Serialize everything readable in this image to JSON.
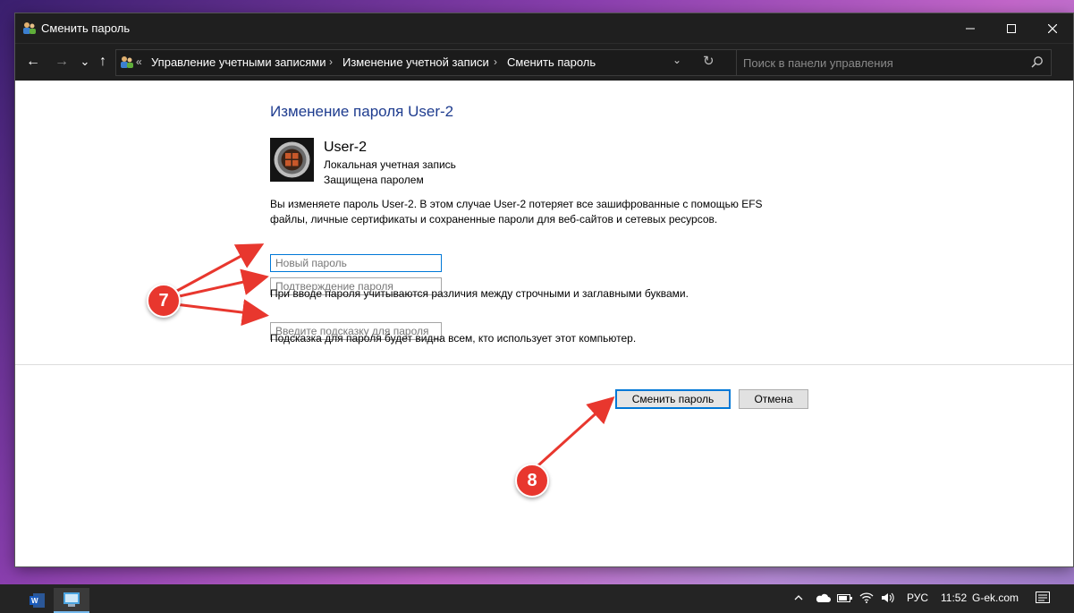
{
  "window": {
    "title": "Сменить пароль",
    "controls": {
      "minimize": "—",
      "maximize": "☐",
      "close": "✕"
    }
  },
  "address_bar": {
    "back": "←",
    "forward": "→",
    "history": "⌄",
    "up": "↑",
    "overflow": "«",
    "breadcrumbs": [
      "Управление учетными записями",
      "Изменение учетной записи",
      "Сменить пароль"
    ],
    "separator": "›",
    "dropdown": "⌄",
    "refresh": "↻",
    "search_placeholder": "Поиск в панели управления"
  },
  "page": {
    "heading": "Изменение пароля User-2",
    "user_name": "User-2",
    "account_type": "Локальная учетная запись",
    "protection": "Защищена паролем",
    "warning_line1": "Вы изменяете пароль User-2. В этом случае User-2 потеряет все зашифрованные с помощью EFS",
    "warning_line2": "файлы, личные сертификаты и сохраненные пароли для веб-сайтов и сетевых ресурсов.",
    "new_password_placeholder": "Новый пароль",
    "confirm_password_placeholder": "Подтверждение пароля",
    "case_note": "При вводе пароля учитываются различия между строчными и заглавными буквами.",
    "hint_placeholder": "Введите подсказку для пароля",
    "hint_note": "Подсказка для пароля будет видна всем, кто использует этот компьютер.",
    "change_button": "Сменить пароль",
    "cancel_button": "Отмена"
  },
  "annotations": {
    "step7": "7",
    "step8": "8",
    "color": "#e8372e"
  },
  "taskbar": {
    "tray_language": "РУС",
    "tray_time": "11:52",
    "tray_site": "G-ek.com"
  }
}
